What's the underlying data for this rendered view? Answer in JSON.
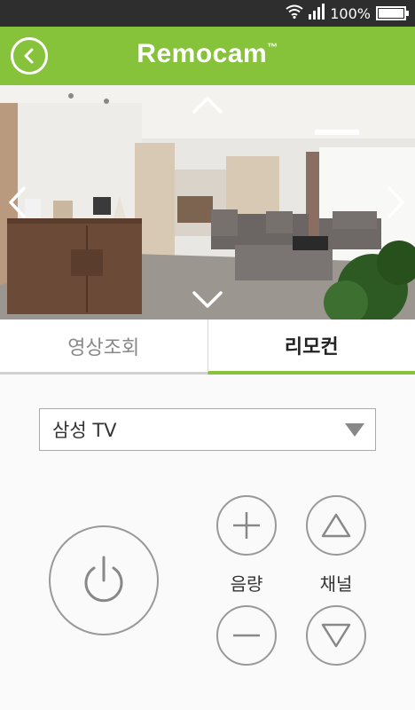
{
  "status_bar": {
    "battery": "100%",
    "battery_level": 1.0,
    "wifi_icon": "wifi-icon",
    "signal_icon": "signal-icon"
  },
  "header": {
    "title": "Remocam",
    "trademark": "™",
    "back_icon": "chevron-left-icon"
  },
  "tabs": [
    {
      "label": "영상조회",
      "active": false
    },
    {
      "label": "리모컨",
      "active": true
    }
  ],
  "remote": {
    "device": "삼성 TV",
    "volume_label": "음량",
    "channel_label": "채널"
  },
  "colors": {
    "brand": "#86c33b",
    "status_bar": "#2e2e2e"
  }
}
